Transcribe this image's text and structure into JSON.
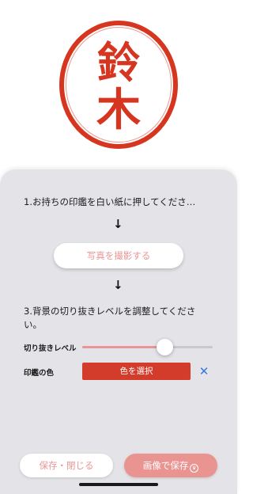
{
  "stamp": {
    "characters": [
      "鈴",
      "木"
    ],
    "color": "#d6361f"
  },
  "steps": {
    "step1": "1.お持ちの印鑑を白い紙に押してくださ…",
    "arrow": "↓",
    "photo_button": "写真を撮影する",
    "step3": "3.背景の切り抜きレベルを調整してください。"
  },
  "controls": {
    "cutout_label": "切り抜きレベル",
    "cutout_level": 0.63,
    "color_label": "印鑑の色",
    "color_button": "色を選択",
    "clear_symbol": "✕",
    "selected_color": "#d33b2a"
  },
  "footer": {
    "save_close": "保存・閉じる",
    "save_image": "画像で保存",
    "save_image_icon": "crown-icon"
  },
  "colors": {
    "accent_pink": "#e99694",
    "panel_bg": "#e4e4e8",
    "link_blue": "#3b74e0"
  }
}
